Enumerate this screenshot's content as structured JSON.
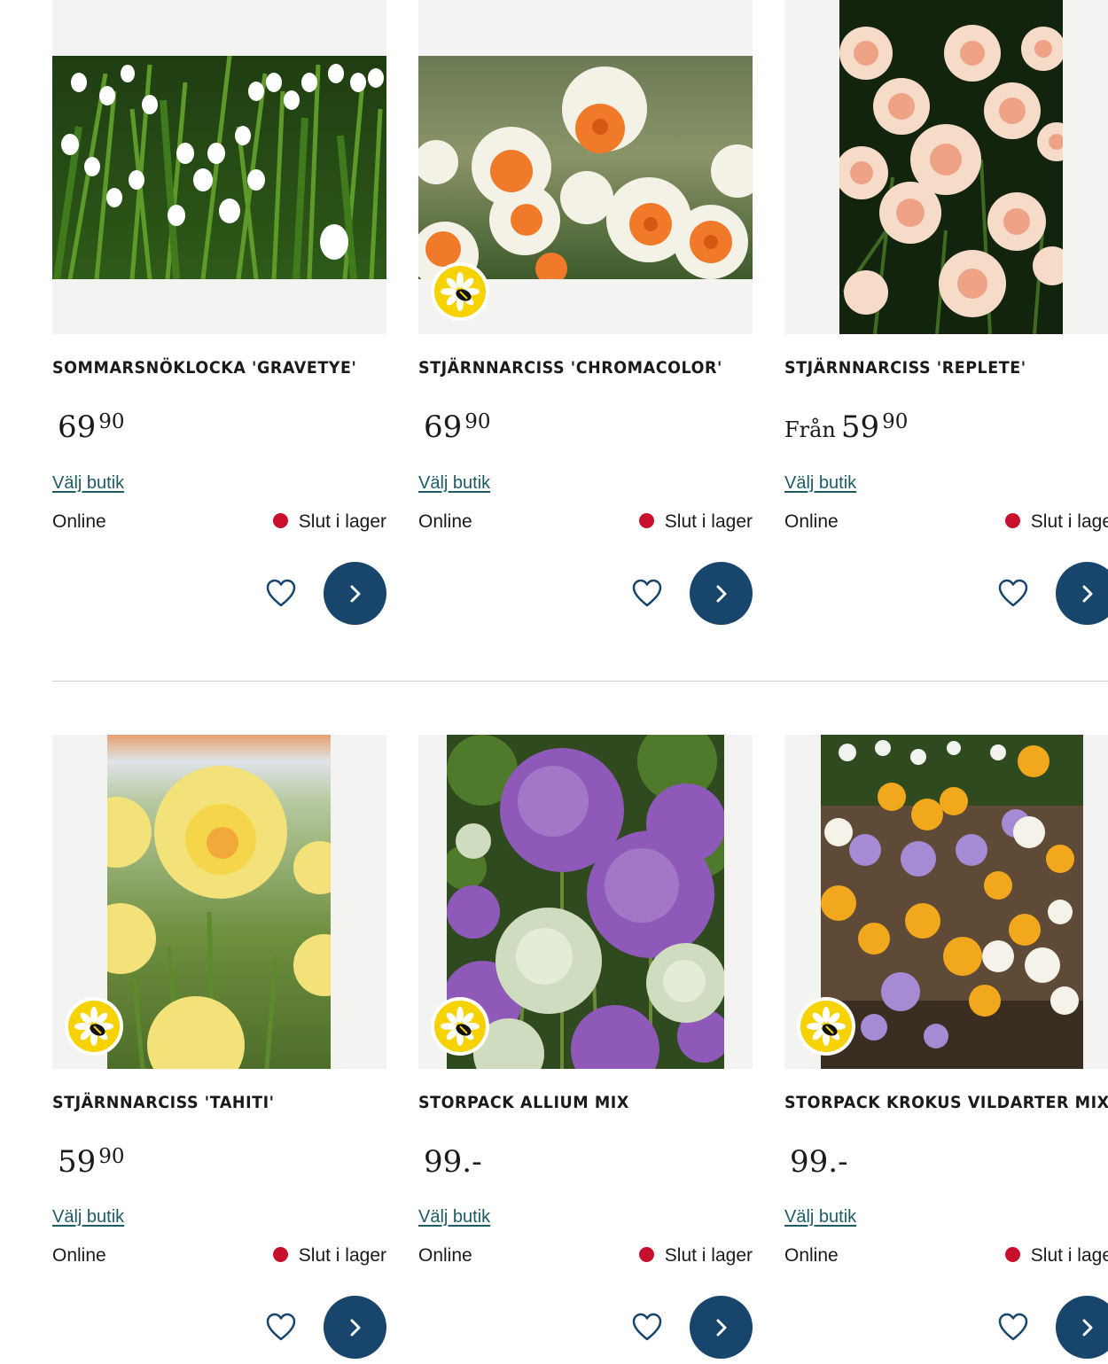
{
  "colors": {
    "link": "#1d5c63",
    "out_of_stock_dot": "#c8102e",
    "button": "#17456b",
    "badge": "#f6d200",
    "image_bg": "#f3f3f2"
  },
  "common": {
    "store_link": "Välj butik",
    "online_label": "Online",
    "stock_label": "Slut i lager",
    "heart_icon": "heart-outline-icon",
    "arrow_icon": "chevron-right-icon",
    "badge_icon": "bee-flower-icon"
  },
  "products": [
    {
      "name": "SOMMARSNÖKLOCKA 'GRAVETYE'",
      "price_prefix": "",
      "price_main": "69",
      "price_cents": "90",
      "price_dash": "",
      "badge": false,
      "image": "white summer snowflake flowers"
    },
    {
      "name": "STJÄRNNARCISS 'CHROMACOLOR'",
      "price_prefix": "",
      "price_main": "69",
      "price_cents": "90",
      "price_dash": "",
      "badge": true,
      "image": "white daffodils with orange cups"
    },
    {
      "name": "STJÄRNNARCISS 'REPLETE'",
      "price_prefix": "Från",
      "price_main": "59",
      "price_cents": "90",
      "price_dash": "",
      "badge": false,
      "image": "double peach daffodils"
    },
    {
      "name": "STJÄRNNARCISS 'TAHITI'",
      "price_prefix": "",
      "price_main": "59",
      "price_cents": "90",
      "price_dash": "",
      "badge": true,
      "image": "yellow double daffodil"
    },
    {
      "name": "STORPACK ALLIUM MIX",
      "price_prefix": "",
      "price_main": "99.",
      "price_cents": "",
      "price_dash": "-",
      "badge": true,
      "image": "purple and white allium"
    },
    {
      "name": "STORPACK KROKUS VILDARTER MIX",
      "price_prefix": "",
      "price_main": "99.",
      "price_cents": "",
      "price_dash": "-",
      "badge": true,
      "image": "mixed crocus flowers"
    }
  ]
}
